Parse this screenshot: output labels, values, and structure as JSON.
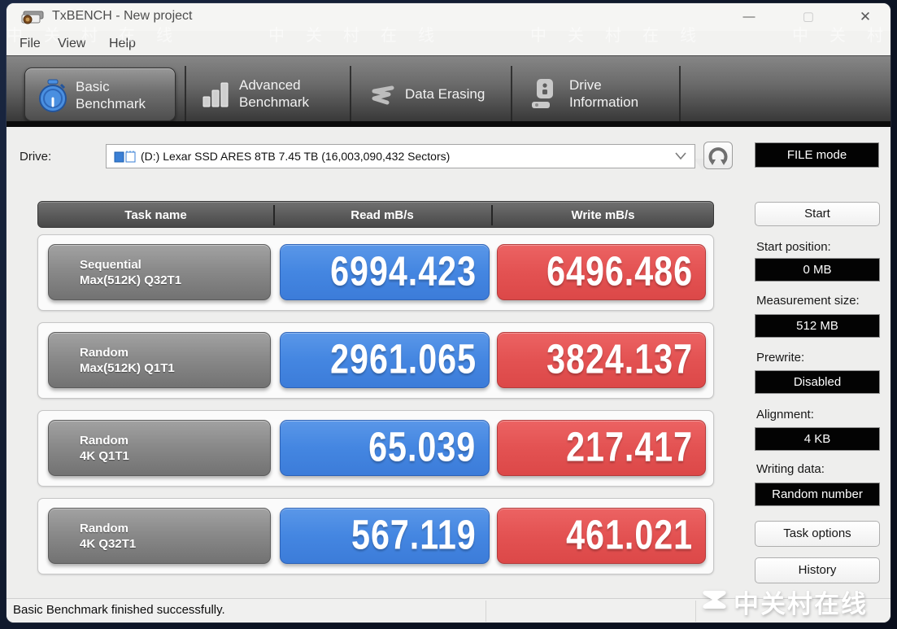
{
  "window": {
    "title": "TxBENCH - New project",
    "controls": {
      "minimize": "—",
      "maximize": "▢",
      "close": "✕"
    }
  },
  "menu": {
    "items": [
      "File",
      "View",
      "Help"
    ]
  },
  "tabs": [
    {
      "line1": "Basic",
      "line2": "Benchmark",
      "active": true
    },
    {
      "line1": "Advanced",
      "line2": "Benchmark",
      "active": false
    },
    {
      "line1": "Data Erasing",
      "line2": "",
      "active": false
    },
    {
      "line1": "Drive",
      "line2": "Information",
      "active": false
    }
  ],
  "drive": {
    "label": "Drive:",
    "selected": "(D:) Lexar SSD ARES 8TB  7.45 TB (16,003,090,432 Sectors)",
    "file_mode_label": "FILE mode"
  },
  "table": {
    "headers": [
      "Task name",
      "Read mB/s",
      "Write mB/s"
    ],
    "rows": [
      {
        "task_line1": "Sequential",
        "task_line2": "Max(512K) Q32T1",
        "read": "6994.423",
        "write": "6496.486"
      },
      {
        "task_line1": "Random",
        "task_line2": "Max(512K) Q1T1",
        "read": "2961.065",
        "write": "3824.137"
      },
      {
        "task_line1": "Random",
        "task_line2": "4K Q1T1",
        "read": "65.039",
        "write": "217.417"
      },
      {
        "task_line1": "Random",
        "task_line2": "4K Q32T1",
        "read": "567.119",
        "write": "461.021"
      }
    ]
  },
  "sidebar": {
    "start_label": "Start",
    "fields": [
      {
        "label": "Start position:",
        "value": "0 MB"
      },
      {
        "label": "Measurement size:",
        "value": "512 MB"
      },
      {
        "label": "Prewrite:",
        "value": "Disabled"
      },
      {
        "label": "Alignment:",
        "value": "4 KB"
      },
      {
        "label": "Writing data:",
        "value": "Random number"
      }
    ],
    "task_options_label": "Task options",
    "history_label": "History"
  },
  "status": {
    "message": "Basic Benchmark finished successfully."
  },
  "watermark": {
    "text": "中关村在线"
  },
  "colors": {
    "read_blue": "#4486e1",
    "write_red": "#e35252",
    "task_gray": "#8a8a8a",
    "tabband_dark": "#3a3a3a",
    "field_black": "#030303"
  }
}
